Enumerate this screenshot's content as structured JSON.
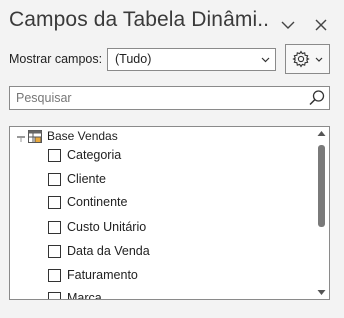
{
  "panel": {
    "title": "Campos da Tabela Dinâmi...",
    "show_fields_label": "Mostrar campos:",
    "show_fields_value": "(Tudo)",
    "search_placeholder": "Pesquisar"
  },
  "tree": {
    "root_label": "Base Vendas",
    "fields": [
      {
        "label": "Categoria",
        "checked": false
      },
      {
        "label": "Cliente",
        "checked": false
      },
      {
        "label": "Continente",
        "checked": false
      },
      {
        "label": "Custo Unitário",
        "checked": false
      },
      {
        "label": "Data da Venda",
        "checked": false
      },
      {
        "label": "Faturamento",
        "checked": false
      },
      {
        "label": "Marca",
        "checked": false
      }
    ]
  },
  "icons": {
    "options": "chevron-down-icon",
    "close": "close-icon",
    "settings": "gear-icon",
    "search": "search-icon",
    "table": "table-icon"
  }
}
